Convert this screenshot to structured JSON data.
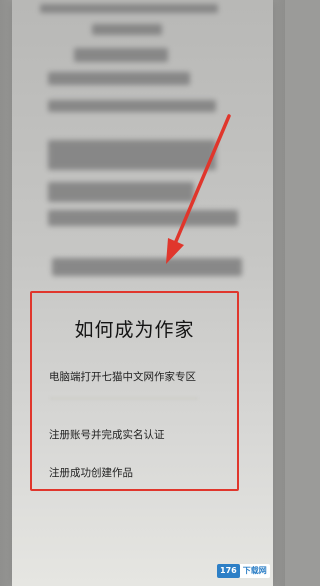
{
  "panel": {
    "title": "如何成为作家",
    "steps": [
      "电脑端打开七猫中文网作家专区",
      "注册账号并完成实名认证",
      "注册成功创建作品"
    ]
  },
  "watermark": {
    "number": "176",
    "text": "下载网"
  },
  "colors": {
    "highlight": "#e0362c",
    "watermark_blue": "#2d7fc6"
  }
}
